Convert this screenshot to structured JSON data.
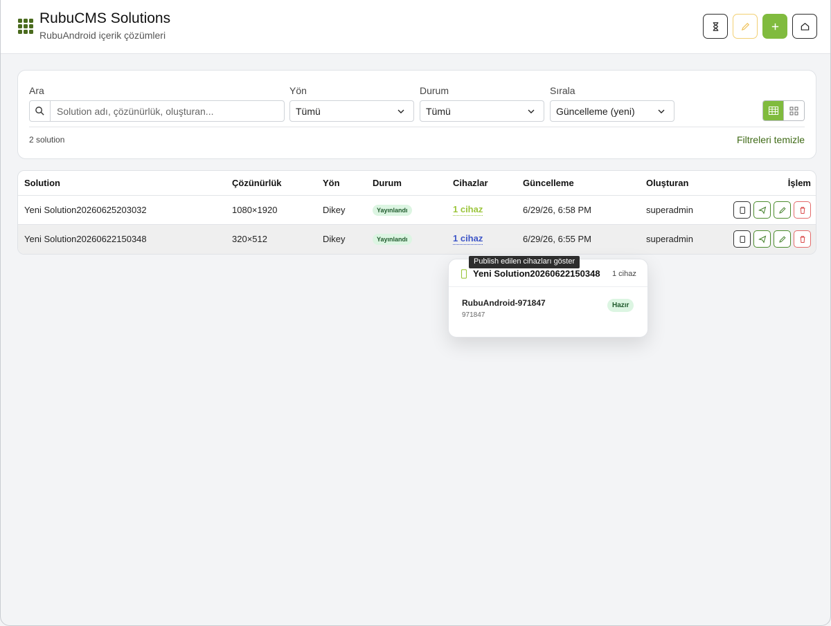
{
  "header": {
    "title": "RubuCMS Solutions",
    "subtitle": "RubuAndroid içerik çözümleri",
    "brand_color": "#4a6b1e",
    "accent_color": "#80bb3e",
    "buttons": [
      {
        "icon": "hourglass-icon"
      },
      {
        "icon": "pen-icon"
      },
      {
        "icon": "plus-icon"
      },
      {
        "icon": "home-icon"
      }
    ]
  },
  "filters": {
    "search_label": "Ara",
    "search_placeholder": "Solution adı, çözünürlük, oluşturan...",
    "search_value": "",
    "orientation_label": "Yön",
    "orientation_value": "Tümü",
    "status_label": "Durum",
    "status_value": "Tümü",
    "sort_label": "Sırala",
    "sort_value": "Güncelleme (yeni)",
    "view_mode": "table",
    "count_text": "2 solution",
    "clear_label": "Filtreleri temizle"
  },
  "table": {
    "headers": {
      "solution": "Solution",
      "resolution": "Çözünürlük",
      "orientation": "Yön",
      "status": "Durum",
      "devices": "Cihazlar",
      "updated": "Güncelleme",
      "creator": "Oluşturan",
      "actions": "İşlem"
    },
    "rows": [
      {
        "name": "Yeni Solution20260625203032",
        "resolution": "1080×1920",
        "orientation": "Dikey",
        "status": "Yayınlandı",
        "devices": "1 cihaz",
        "updated": "6/29/26, 6:58 PM",
        "creator": "superadmin"
      },
      {
        "name": "Yeni Solution20260622150348",
        "resolution": "320×512",
        "orientation": "Dikey",
        "status": "Yayınlandı",
        "devices": "1 cihaz",
        "updated": "6/29/26, 6:55 PM",
        "creator": "superadmin"
      }
    ]
  },
  "tooltip": "Publish edilen cihazları göster",
  "popover": {
    "title": "Yeni Solution20260622150348",
    "count": "1 cihaz",
    "devices": [
      {
        "name": "RubuAndroid-971847",
        "id": "971847",
        "status": "Hazır"
      }
    ]
  }
}
